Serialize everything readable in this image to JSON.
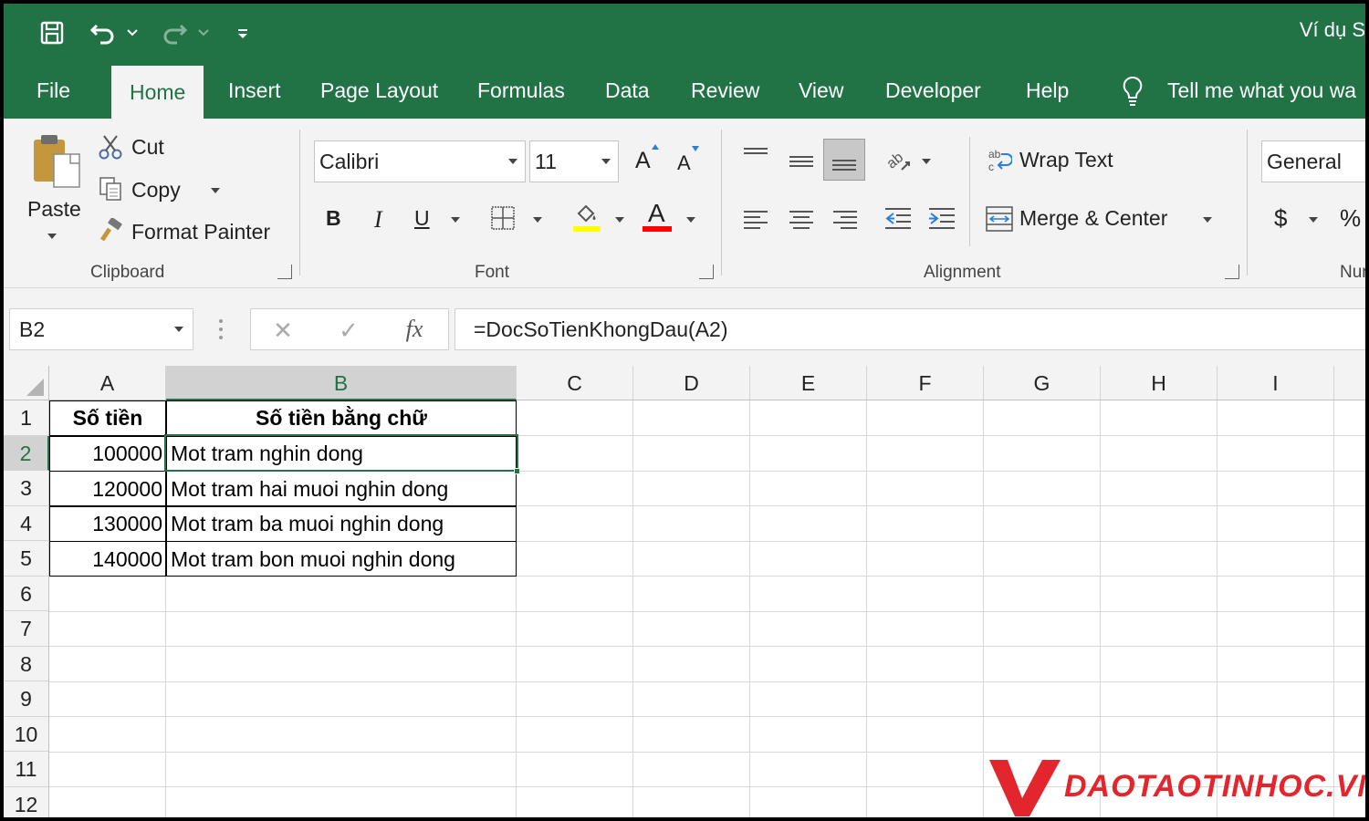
{
  "window": {
    "title": "Ví dụ S"
  },
  "quick_access": {
    "save": "save-icon",
    "undo": "undo-icon",
    "redo": "redo-icon",
    "customize": "customize-icon"
  },
  "tabs": [
    "File",
    "Home",
    "Insert",
    "Page Layout",
    "Formulas",
    "Data",
    "Review",
    "View",
    "Developer",
    "Help"
  ],
  "active_tab": "Home",
  "tell_me": "Tell me what you wa",
  "ribbon": {
    "clipboard": {
      "paste": "Paste",
      "cut": "Cut",
      "copy": "Copy",
      "format_painter": "Format Painter",
      "label": "Clipboard"
    },
    "font": {
      "font_name": "Calibri",
      "font_size": "11",
      "bold": "B",
      "italic": "I",
      "underline": "U",
      "grow": "A",
      "shrink": "A",
      "font_color": "A",
      "label": "Font"
    },
    "alignment": {
      "wrap_text": "Wrap Text",
      "merge_center": "Merge & Center",
      "label": "Alignment"
    },
    "number": {
      "format": "General",
      "currency": "$",
      "percent": "%",
      "label": "Nur"
    }
  },
  "formula_bar": {
    "name_box": "B2",
    "cancel": "✕",
    "enter": "✓",
    "fx": "fx",
    "formula": "=DocSoTienKhongDau(A2)"
  },
  "columns": [
    "A",
    "B",
    "C",
    "D",
    "E",
    "F",
    "G",
    "H",
    "I"
  ],
  "rows": [
    "1",
    "2",
    "3",
    "4",
    "5",
    "6",
    "7",
    "8",
    "9",
    "10",
    "11",
    "12"
  ],
  "table": {
    "headers": [
      "Số tiền",
      "Số tiền bằng chữ"
    ],
    "rows": [
      [
        "100000",
        "Mot tram nghin dong"
      ],
      [
        "120000",
        "Mot tram hai muoi nghin dong"
      ],
      [
        "130000",
        "Mot tram ba muoi nghin dong"
      ],
      [
        "140000",
        "Mot tram bon muoi nghin dong"
      ]
    ]
  },
  "watermark": "DAOTAOTINHOC.VN",
  "colors": {
    "excel_green": "#217346",
    "ribbon_bg": "#f3f3f3",
    "watermark_red": "#e3262d",
    "highlight_yellow": "#ffff00",
    "font_red": "#ff0000"
  }
}
